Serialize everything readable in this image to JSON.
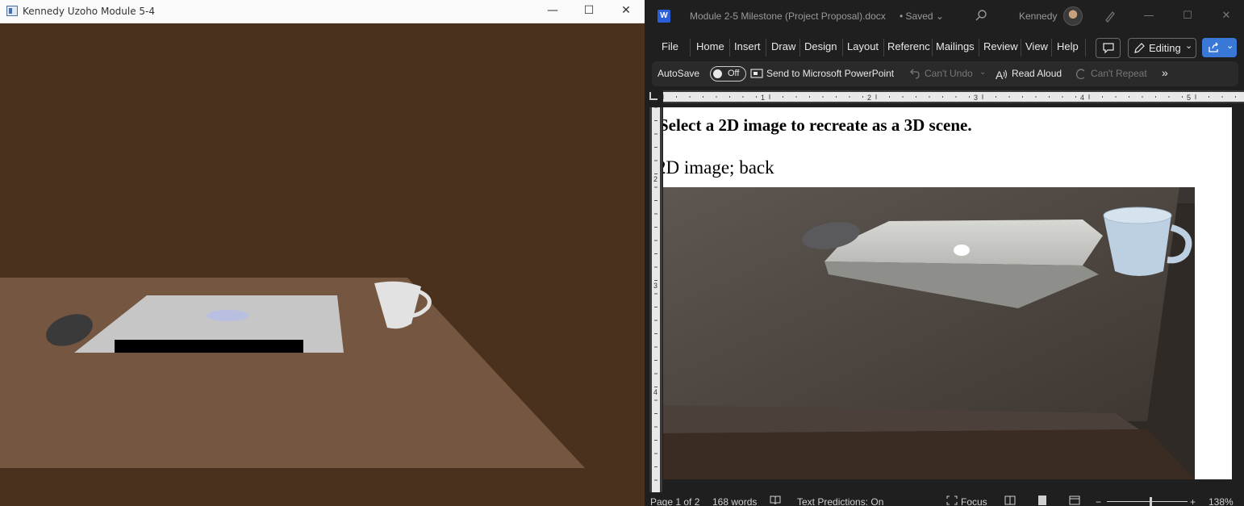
{
  "left_window": {
    "title": "Kennedy Uzoho Module 5-4",
    "minimize": "—",
    "maximize": "☐",
    "close": "✕",
    "colors": {
      "wall": "#4a311d",
      "table": "#755640",
      "laptop": "#c6c6c6",
      "mouse": "#3a3a3a",
      "mug": "#e2e2e2"
    }
  },
  "word": {
    "app_letter": "W",
    "doc_title": "Module 2-5 Milestone (Project Proposal).docx",
    "saved_status": "• Saved ⌄",
    "user": "Kennedy",
    "menu_tabs": [
      "File",
      "Home",
      "Insert",
      "Draw",
      "Design",
      "Layout",
      "Referenc",
      "Mailings",
      "Review",
      "View",
      "Help"
    ],
    "editing_label": "Editing",
    "toolbar": {
      "autosave": "AutoSave",
      "toggle": "Off",
      "send_ppt": "Send to Microsoft PowerPoint",
      "cant_undo": "Can't Undo",
      "read_aloud": "Read Aloud",
      "cant_repeat": "Can't Repeat",
      "more": "»"
    },
    "ruler_numbers": [
      "1",
      "2",
      "3",
      "4",
      "5"
    ],
    "vruler_numbers": [
      "1",
      "2",
      "3",
      "4"
    ],
    "content": {
      "heading": "Select a 2D image to recreate as a 3D scene.",
      "paragraph": "2D image; back"
    },
    "status": {
      "page": "Page 1 of 2",
      "words": "168 words",
      "predictions": "Text Predictions: On",
      "focus": "Focus",
      "zoom": "138%"
    }
  }
}
